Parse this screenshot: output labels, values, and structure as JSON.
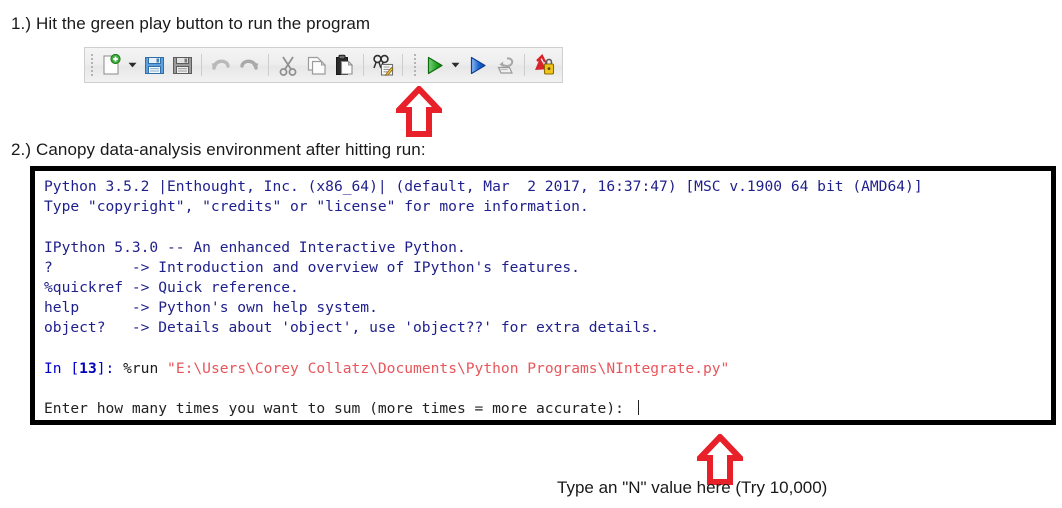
{
  "steps": {
    "step1": "1.) Hit the green play button to run the program",
    "step2": "2.) Canopy data-analysis environment after hitting run:"
  },
  "toolbar": {
    "buttons": [
      {
        "name": "new-file-icon",
        "label": "New File"
      },
      {
        "name": "new-file-dropdown-icon",
        "label": "New File Options"
      },
      {
        "name": "save-icon",
        "label": "Save"
      },
      {
        "name": "save-as-icon",
        "label": "Save As"
      },
      {
        "name": "undo-icon",
        "label": "Undo"
      },
      {
        "name": "redo-icon",
        "label": "Redo"
      },
      {
        "name": "cut-icon",
        "label": "Cut"
      },
      {
        "name": "copy-icon",
        "label": "Copy"
      },
      {
        "name": "paste-icon",
        "label": "Paste"
      },
      {
        "name": "find-replace-icon",
        "label": "Find and Replace"
      },
      {
        "name": "run-play-icon",
        "label": "Run File"
      },
      {
        "name": "run-dropdown-icon",
        "label": "Run Options"
      },
      {
        "name": "run-selection-icon",
        "label": "Run Selection"
      },
      {
        "name": "debug-icon",
        "label": "Debug"
      },
      {
        "name": "kernel-lock-icon",
        "label": "Interrupt Kernel"
      }
    ]
  },
  "annotations": {
    "arrow_play": "up-arrow-pointing-to-run-button",
    "arrow_input": "up-arrow-pointing-to-input-prompt",
    "caption": "Type an \"N\" value here (Try 10,000)"
  },
  "console": {
    "lines": [
      {
        "type": "banner",
        "text": "Python 3.5.2 |Enthought, Inc. (x86_64)| (default, Mar  2 2017, 16:37:47) [MSC v.1900 64 bit (AMD64)]"
      },
      {
        "type": "banner",
        "text": "Type \"copyright\", \"credits\" or \"license\" for more information."
      },
      {
        "type": "blank",
        "text": ""
      },
      {
        "type": "banner",
        "text": "IPython 5.3.0 -- An enhanced Interactive Python."
      },
      {
        "type": "banner",
        "text": "?         -> Introduction and overview of IPython's features."
      },
      {
        "type": "banner",
        "text": "%quickref -> Quick reference."
      },
      {
        "type": "banner",
        "text": "help      -> Python's own help system."
      },
      {
        "type": "banner",
        "text": "object?   -> Details about 'object', use 'object??' for extra details."
      },
      {
        "type": "blank",
        "text": ""
      },
      {
        "type": "input",
        "prompt_pre": "In [",
        "prompt_num": "13",
        "prompt_post": "]: ",
        "command": "%run ",
        "path": "\"E:\\Users\\Corey Collatz\\Documents\\Python Programs\\NIntegrate.py\""
      },
      {
        "type": "blank",
        "text": ""
      },
      {
        "type": "prompt",
        "text": "Enter how many times you want to sum (more times = more accurate): "
      }
    ]
  },
  "colors": {
    "banner_text": "#1f1f8c",
    "input_prompt": "#0000cc",
    "path_string": "#e8565c",
    "annotation_red": "#e8202a",
    "console_border": "#000000",
    "toolbar_bg": "#eeeeee"
  }
}
